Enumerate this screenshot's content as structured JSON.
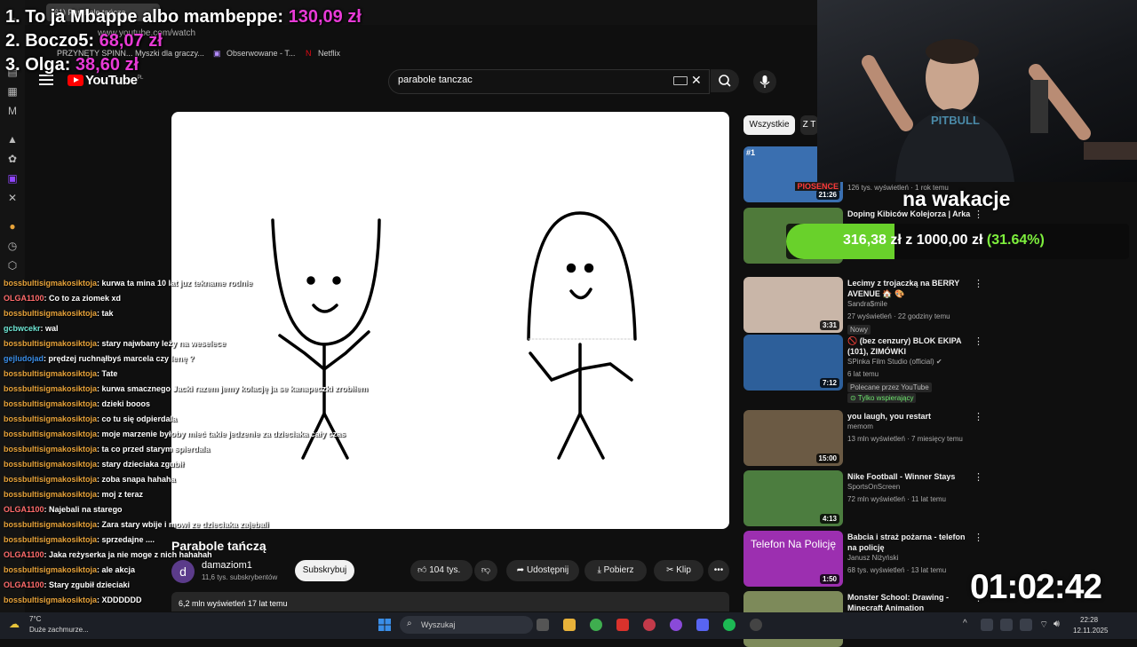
{
  "browser": {
    "tab_title": "(61) Parabole tańczą",
    "address": "www.youtube.com/watch",
    "bookmarks": [
      "PRZYNĘTY SPINN...",
      "Myszki dla graczy...",
      "Obserwowane - T...",
      "Netflix"
    ]
  },
  "donors": [
    {
      "rank_name": "1. To ja Mbappe albo mambeppe:",
      "amount": "130,09 zł"
    },
    {
      "rank_name": "2. Boczo5:",
      "amount": "68,07 zł"
    },
    {
      "rank_name": "3. Olga:",
      "amount": "38,60 zł"
    }
  ],
  "youtube": {
    "logo_text": "YouTube",
    "logo_country": "PL",
    "search_query": "parabole tanczac"
  },
  "video": {
    "title": "Parabole tańczą",
    "channel": "damaziom1",
    "channel_initial": "d",
    "subscribers": "11,6 tys. subskrybentów",
    "subscribe_label": "Subskrybuj",
    "likes": "104 tys.",
    "share_label": "Udostępnij",
    "download_label": "Pobierz",
    "clip_label": "Klip",
    "views_age": "6,2 mln wyświetleń  17 lat temu"
  },
  "chat": [
    {
      "user": "bossbultisigmakosiktoja",
      "msg": ": kurwa ta mina 10 lat juz tekname rodnie",
      "cls": ""
    },
    {
      "user": "OLGA1100",
      "msg": ": Co to za ziomek xd",
      "cls": "olga"
    },
    {
      "user": "bossbultisigmakosiktoja",
      "msg": ": tak",
      "cls": ""
    },
    {
      "user": "gcbwcekr",
      "msg": ": wal",
      "cls": "cyan"
    },
    {
      "user": "bossbultisigmakosiktoja",
      "msg": ": stary najwbany leży na weselece",
      "cls": ""
    },
    {
      "user": "gejludojad",
      "msg": ": prędzej ruchnąłbyś marcela czy lenę ?",
      "cls": "blue"
    },
    {
      "user": "bossbultisigmakosiktoja",
      "msg": ": Tate",
      "cls": ""
    },
    {
      "user": "bossbultisigmakosiktoja",
      "msg": ": kurwa smacznego Jacki razem jemy kolację ja se kanapeczki zrobiłem",
      "cls": ""
    },
    {
      "user": "bossbultisigmakosiktoja",
      "msg": ": dzieki booos",
      "cls": ""
    },
    {
      "user": "bossbultisigmakosiktoja",
      "msg": ": co tu się odpierdala",
      "cls": ""
    },
    {
      "user": "bossbultisigmakosiktoja",
      "msg": ": moje marzenie byłoby mieć takie jedzenie za dzieciaka cały czas",
      "cls": ""
    },
    {
      "user": "bossbultisigmakosiktoja",
      "msg": ": ta co przed starym spierdala",
      "cls": ""
    },
    {
      "user": "bossbultisigmakosiktoja",
      "msg": ": stary dzieciaka zgubił",
      "cls": ""
    },
    {
      "user": "bossbultisigmakosiktoja",
      "msg": ": zoba snapa hahaha",
      "cls": ""
    },
    {
      "user": "bossbultisigmakosiktoja",
      "msg": ": moj z teraz",
      "cls": ""
    },
    {
      "user": "OLGA1100",
      "msg": ": Najebali na starego",
      "cls": "olga"
    },
    {
      "user": "bossbultisigmakosiktoja",
      "msg": ": Zara stary wbije i mowi ze dzieciaka zajebali",
      "cls": ""
    },
    {
      "user": "bossbultisigmakosiktoja",
      "msg": ": sprzedajne ....",
      "cls": ""
    },
    {
      "user": "OLGA1100",
      "msg": ": Jaka reżyserka ja nie moge z nich hahahah",
      "cls": "olga"
    },
    {
      "user": "bossbultisigmakosiktoja",
      "msg": ": ale akcja",
      "cls": ""
    },
    {
      "user": "OLGA1100",
      "msg": ": Stary zgubił dzieciaki",
      "cls": "olga"
    },
    {
      "user": "bossbultisigmakosiktoja",
      "msg": ": XDDDDDD",
      "cls": ""
    }
  ],
  "sidebar": {
    "chips": [
      "Wszystkie",
      "Z T"
    ],
    "videos": [
      {
        "title": "",
        "channel": "",
        "meta": "126 tys. wyświetleń · 1 rok temu",
        "duration": "21:26",
        "badge": "",
        "thumb": "#3a6fb0"
      },
      {
        "title": "Doping Kibiców Kolejorza | Arka",
        "channel": "",
        "meta": "",
        "duration": "",
        "badge": "",
        "thumb": "#4f7a3a"
      },
      {
        "title": "Lecimy z trojaczką na BERRY AVENUE 🏠 🎨",
        "channel": "Sandra$mile",
        "meta": "27 wyświetleń · 22 godziny temu",
        "duration": "3:31",
        "badge": "Nowy",
        "thumb": "#c9b6a8"
      },
      {
        "title": "🚫 (bez cenzury) BLOK EKIPA (101), ZIMÓWKI",
        "channel": "SPinka Film Studio (official) ✔",
        "meta": "6 lat temu",
        "duration": "7:12",
        "badge": "Polecane przez YouTube",
        "badge2": "⊙ Tylko wspierający",
        "thumb": "#2d5f9a"
      },
      {
        "title": "you laugh, you restart",
        "channel": "memom",
        "meta": "13 mln wyświetleń · 7 miesięcy temu",
        "duration": "15:00",
        "badge": "",
        "thumb": "#6b5a44"
      },
      {
        "title": "Nike Football  - Winner Stays",
        "channel": "SportsOnScreen",
        "meta": "72 mln wyświetleń · 11 lat temu",
        "duration": "4:13",
        "badge": "",
        "thumb": "#4c7d3f"
      },
      {
        "title": "Babcia i straż pożarna - telefon na policję",
        "channel": "Janusz Niżyński",
        "meta": "68 tys. wyświetleń · 13 lat temu",
        "duration": "1:50",
        "badge": "",
        "thumb": "#9c2fb0"
      },
      {
        "title": "Monster School: Drawing - Minecraft Animation",
        "channel": "",
        "meta": "",
        "duration": "",
        "badge": "",
        "thumb": "#7d8a5a"
      }
    ],
    "thumb7_text": "Telefon Na Policję",
    "thumb1_overlay": "#1",
    "thumb1_text": "PIOSENCE"
  },
  "overlay": {
    "goal_caption": "na wakacje",
    "goal_current": "316,38 zł",
    "goal_separator": "z",
    "goal_target": "1000,00 zł",
    "goal_percent": "(31.64%)",
    "goal_fraction": 0.3164,
    "timer": "01:02:42"
  },
  "taskbar": {
    "temp": "7°C",
    "weather": "Duże zachmurze...",
    "search": "Wyszukaj",
    "time": "22:28",
    "date": "12.11.2025"
  }
}
